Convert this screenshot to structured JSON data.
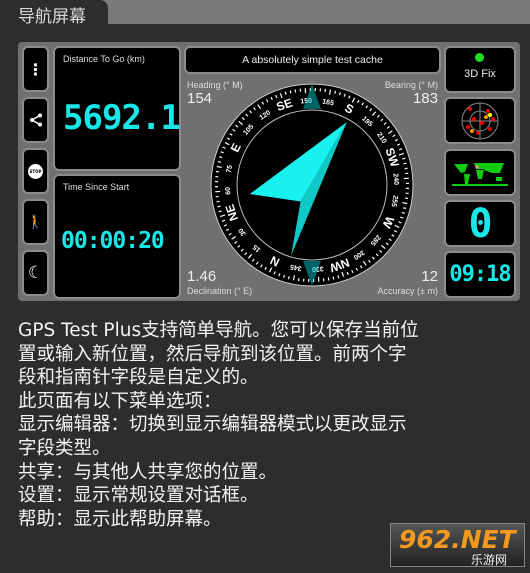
{
  "tab": {
    "title": "导航屏幕"
  },
  "sidebar": {
    "buttons": [
      {
        "icon": "more-vert-icon"
      },
      {
        "icon": "share-icon"
      },
      {
        "icon": "stop-icon",
        "label": "STOP"
      },
      {
        "icon": "person-flag-icon"
      },
      {
        "icon": "moon-icon"
      }
    ]
  },
  "distance": {
    "label": "Distance To Go (km)",
    "value": "5692.1"
  },
  "time": {
    "label": "Time Since Start",
    "value": "00:00:20"
  },
  "cache": {
    "title": "A absolutely simple test cache"
  },
  "compass": {
    "heading_label": "Heading (° M)",
    "heading": "154",
    "bearing_label": "Bearing (° M)",
    "bearing": "183",
    "declination": "1.46",
    "declination_label": "Declination (° E)",
    "accuracy": "12",
    "accuracy_label": "Accuracy (± m)",
    "labels": [
      "N",
      "15",
      "30",
      "NE",
      "60",
      "75",
      "E",
      "105",
      "120",
      "SE",
      "150",
      "165",
      "S",
      "195",
      "210",
      "SW",
      "240",
      "255",
      "W",
      "285",
      "300",
      "NW",
      "330",
      "345"
    ],
    "arrow_color": "#19f0f0"
  },
  "status": {
    "fix": "3D Fix",
    "fix_color": "#22dd22",
    "satellites": "0",
    "clock": "09:18"
  },
  "description": [
    "GPS Test Plus支持简单导航。您可以保存当前位",
    "置或输入新位置，然后导航到该位置。前两个字",
    "段和指南针字段是自定义的。",
    "此页面有以下菜单选项：",
    "显示编辑器：切换到显示编辑器模式以更改显示",
    "字段类型。",
    "共享：与其他人共享您的位置。",
    "设置：显示常规设置对话框。",
    "帮助：显示此帮助屏幕。"
  ],
  "watermark": {
    "brand": "962.NET",
    "sub": "乐游网"
  }
}
